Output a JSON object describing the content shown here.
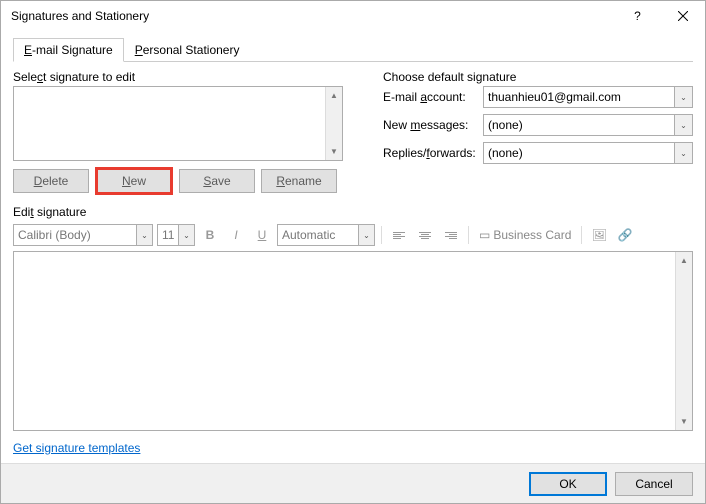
{
  "titlebar": {
    "title": "Signatures and Stationery"
  },
  "tabs": {
    "email": "E-mail Signature",
    "stationery": "Personal Stationery"
  },
  "left": {
    "select_label": "Select signature to edit",
    "delete": "Delete",
    "new": "New",
    "save": "Save",
    "rename": "Rename"
  },
  "right": {
    "choose_label": "Choose default signature",
    "account_label": "E-mail account:",
    "account_value": "thuanhieu01@gmail.com",
    "newmsg_label": "New messages:",
    "newmsg_value": "(none)",
    "replies_label": "Replies/forwards:",
    "replies_value": "(none)"
  },
  "edit": {
    "label": "Edit signature",
    "font": "Calibri (Body)",
    "size": "11",
    "color": "Automatic",
    "business_card": "Business Card"
  },
  "link": "Get signature templates",
  "footer": {
    "ok": "OK",
    "cancel": "Cancel"
  }
}
